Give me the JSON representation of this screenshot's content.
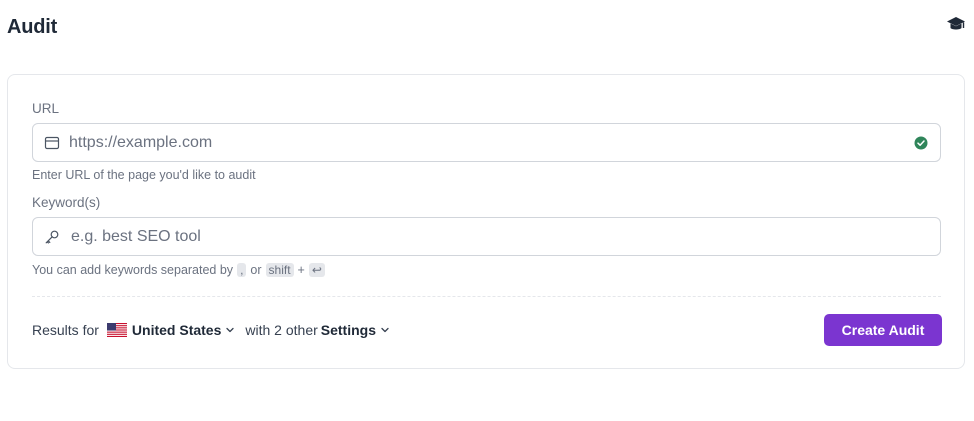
{
  "page": {
    "title": "Audit",
    "help_icon": "graduation-cap-icon"
  },
  "url_field": {
    "label": "URL",
    "placeholder": "https://example.com",
    "value": "",
    "icon": "browser-window-icon",
    "status_icon": "check-circle-icon",
    "hint": "Enter URL of the page you'd like to audit"
  },
  "keyword_field": {
    "label": "Keyword(s)",
    "placeholder": "e.g. best SEO tool",
    "value": "",
    "icon": "key-icon",
    "hint_prefix": "You can add keywords separated by",
    "hint_key_comma": ",",
    "hint_or": "or",
    "hint_key_shift": "shift",
    "hint_plus": "+",
    "hint_key_enter": "↩"
  },
  "footer": {
    "results_for": "Results for",
    "country": "United States",
    "country_flag": "us-flag-icon",
    "with_others": "with 2 other",
    "settings": "Settings",
    "create_button": "Create Audit"
  },
  "colors": {
    "accent": "#7b35d0",
    "success": "#2f855a",
    "border": "#d1d5db",
    "muted_text": "#6b7280"
  }
}
